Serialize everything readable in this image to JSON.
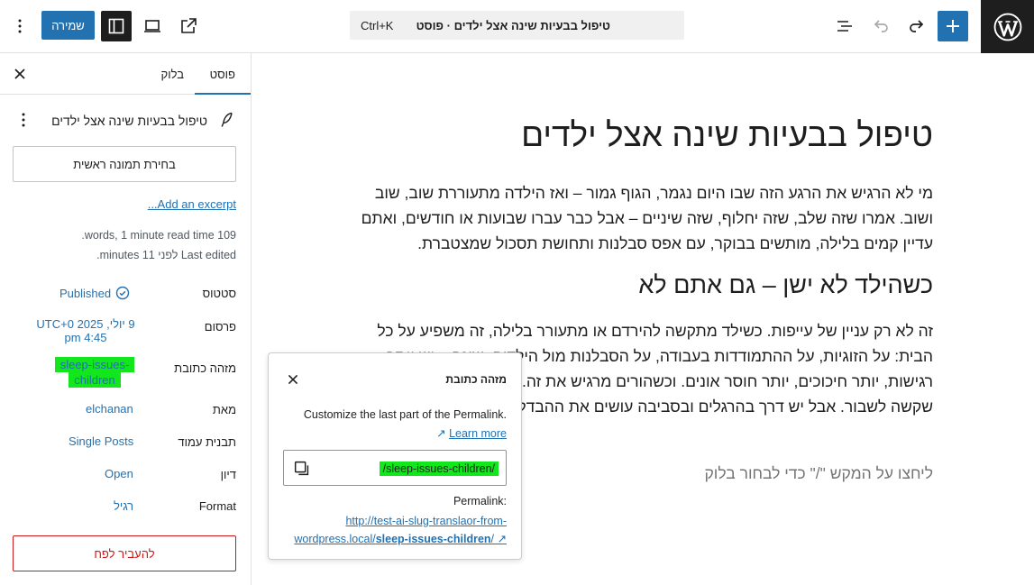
{
  "topbar": {
    "save_label": "שמירה",
    "command_title": "טיפול בבעיות שינה אצל ילדים · פוסט",
    "command_shortcut": "Ctrl+K",
    "icons": {
      "logo": "wordpress-icon",
      "add": "plus-icon",
      "redo": "redo-icon",
      "undo": "undo-icon",
      "outline": "document-overview-icon",
      "external": "external-link-icon",
      "view": "laptop-preview-icon",
      "sidebar": "sidebar-toggle-icon",
      "more": "vertical-dots-icon"
    }
  },
  "sidebar": {
    "tab_post": "פוסט",
    "tab_block": "בלוק",
    "post_title": "טיפול בבעיות שינה אצל ילדים",
    "featured_image_label": "בחירת תמונה ראשית",
    "excerpt_link": "Add an excerpt...",
    "meta_words": "109 words, 1 minute read time.",
    "meta_edited": "Last edited לפני 11 minutes.",
    "rows": [
      {
        "label": "סטטוס",
        "value": "Published"
      },
      {
        "label": "פרסום",
        "value": "9 יולי, 2025 UTC+0 4:45 pm"
      },
      {
        "label": "מזהה כתובת",
        "value": "sleep-issues-children"
      },
      {
        "label": "מאת",
        "value": "elchanan"
      },
      {
        "label": "תבנית עמוד",
        "value": "Single Posts"
      },
      {
        "label": "דיון",
        "value": "Open"
      },
      {
        "label": "Format",
        "value": "רגיל"
      }
    ],
    "publish_date_line1": "9 יולי, 2025 UTC+0",
    "publish_date_line2": "4:45 pm",
    "slug_line1": "sleep-issues-",
    "slug_line2": "children",
    "trash_label": "להעביר לפח"
  },
  "editor": {
    "title": "טיפול בבעיות שינה אצל ילדים",
    "paragraph1": "מי לא הרגיש את הרגע הזה שבו היום נגמר, הגוף גמור – ואז הילדה מתעוררת שוב, שוב ושוב. אמרו שזה שלב, שזה יחלוף, שזה שיניים – אבל כבר עברו שבועות או חודשים, ואתם עדיין קמים בלילה, מותשים בבוקר, עם אפס סבלנות ותחושת תסכול שמצטברת.",
    "heading2": "כשהילד לא ישן – גם אתם לא",
    "paragraph2": "זה לא רק עניין של עייפות. כשילד מתקשה להירדם או מתעורר בלילה, זה משפיע על כל הבית: על הזוגיות, על ההתמודדות בעבודה, על הסבלנות מול הילדים. שינה – יש יותר רגישות, יותר חיכוכים, יותר חוסר אונים. וכשהורים מרגיש את זה. לאט-לאט נוצר מעגל שקשה לשבור. אבל יש דרך בהרגלים ובסביבה עושים את ההבדל.",
    "block_placeholder": "ליחצו על המקש \"/\" כדי לבחור בלוק"
  },
  "slug_popover": {
    "title": "מזהה כתובת",
    "description": "Customize the last part of the Permalink.",
    "learn_more": "Learn more",
    "slug_value": "/sleep-issues-children/",
    "permalink_label": "Permalink:",
    "permalink_base": "http://test-ai-slug-translaor-from-wordpress.local/",
    "permalink_slug": "sleep-issues-children",
    "permalink_tail": "/"
  },
  "colors": {
    "accent": "#2271b1",
    "highlight": "#12e61c",
    "danger": "#cc1818",
    "dark": "#1e1e1e"
  }
}
